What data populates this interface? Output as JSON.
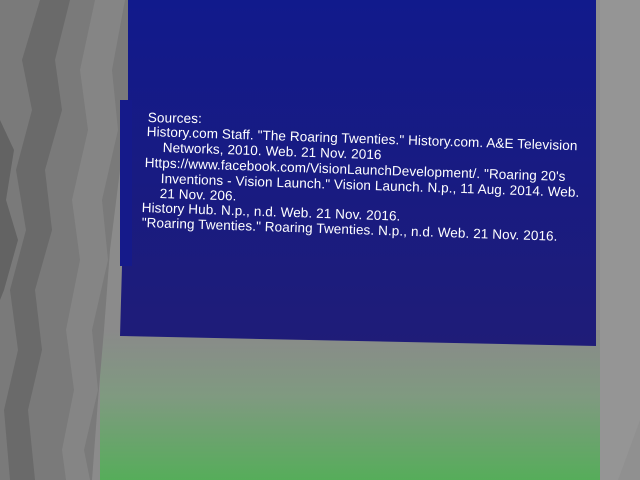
{
  "colors": {
    "panel_top": "#111a8c",
    "panel_bottom": "#1e1d7a",
    "wall_gray": "#8a8a8a",
    "floor_green": "#5faa5f",
    "text": "#ffffff"
  },
  "sources": {
    "heading": "Sources:",
    "lines": [
      "History.com Staff. \"The Roaring Twenties.\" History.com. A&E Television",
      "Networks, 2010. Web. 21 Nov. 2016",
      "Https://www.facebook.com/VisionLaunchDevelopment/. \"Roaring 20's",
      "Inventions - Vision Launch.\" Vision Launch. N.p., 11 Aug. 2014. Web.",
      "21 Nov. 206.",
      "History Hub. N.p., n.d. Web. 21 Nov. 2016.",
      "\"Roaring Twenties.\" Roaring Twenties. N.p., n.d. Web. 21 Nov. 2016."
    ]
  }
}
